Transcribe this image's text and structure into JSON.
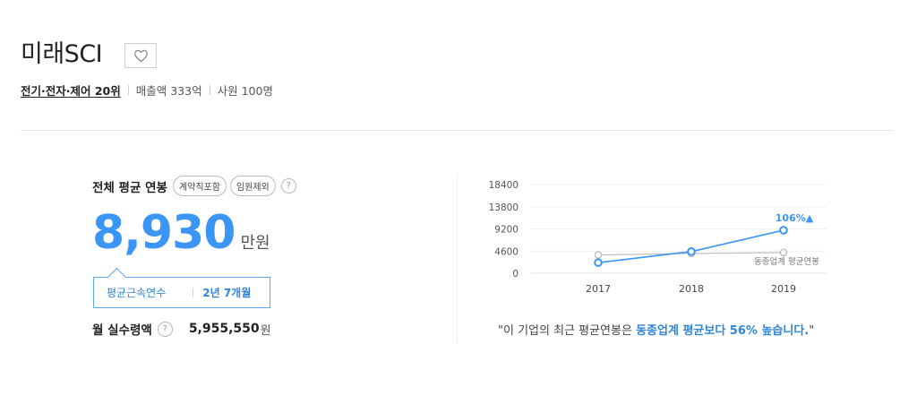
{
  "company": {
    "name": "미래SCI",
    "industry": "전기·전자·제어 20위",
    "revenue": "매출액 333억",
    "employees": "사원 100명"
  },
  "salary": {
    "label": "전체 평균 연봉",
    "tags": [
      "계약직포함",
      "임원제외"
    ],
    "help": "?",
    "value": "8,930",
    "unit": "만원"
  },
  "tenure": {
    "label": "평균근속연수",
    "value": "2년 7개월"
  },
  "monthly": {
    "label": "월 실수령액",
    "help": "?",
    "value": "5,955,550",
    "unit": "원"
  },
  "chart_data": {
    "type": "line",
    "x": [
      "2017",
      "2018",
      "2019"
    ],
    "y_ticks": [
      "18400",
      "13800",
      "9200",
      "4600",
      "0"
    ],
    "ylim": [
      0,
      18400
    ],
    "series": [
      {
        "name": "",
        "values": [
          2200,
          4500,
          8930
        ],
        "color": "#3a95f5"
      },
      {
        "name": "동종업계 평균연봉",
        "values": [
          3800,
          4100,
          4300
        ],
        "color": "#bbbbbb"
      }
    ],
    "annotation": {
      "text": "106%",
      "marker": "▲",
      "color": "#3a95f5"
    },
    "grid": true
  },
  "summary": {
    "prefix": "\"이 기업의 최근 평균연봉은 ",
    "highlight": "동종업계 평균보다 56% 높습니다.",
    "suffix": "\""
  }
}
